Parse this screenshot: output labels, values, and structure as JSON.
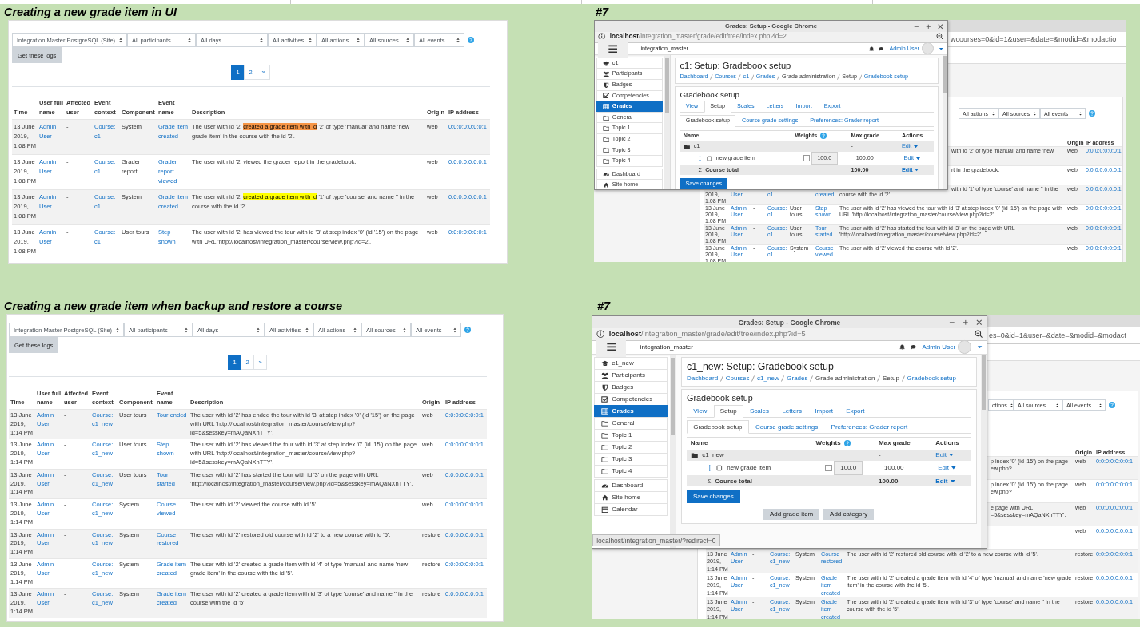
{
  "panels": [
    {
      "kind": "log",
      "heading": "Creating a new grade item in UI",
      "log": {
        "filters": [
          "Integration Master PostgreSQL (Site)",
          "All participants",
          "All days",
          "All activities",
          "All actions",
          "All sources",
          "All events"
        ],
        "get_button": "Get these logs",
        "pages": [
          {
            "label": "1",
            "selected": true
          },
          {
            "label": "2",
            "selected": false
          },
          {
            "label": "»",
            "selected": false
          }
        ],
        "columns": [
          "Time",
          "User full name",
          "Affected user",
          "Event context",
          "Component",
          "Event name",
          "Description",
          "Origin",
          "IP address"
        ],
        "rows": [
          {
            "time": "13 June 2019, 1:08 PM",
            "user": "Admin User",
            "affected": "-",
            "context": "Course: c1",
            "component": "System",
            "event": "Grade item created",
            "description": [
              {
                "text": "The user with id '2' "
              },
              {
                "text": "created a grade item with id",
                "color": "#f79646"
              },
              {
                "text": " '2' of type 'manual' and name 'new grade item' in the course with the id '2'."
              }
            ],
            "origin": "web",
            "ip": "0:0:0:0:0:0:0:1"
          },
          {
            "time": "13 June 2019, 1:08 PM",
            "user": "Admin User",
            "affected": "-",
            "context": "Course: c1",
            "component": "Grader report",
            "event": "Grader report viewed",
            "description": [
              {
                "text": "The user with id '2' viewed the grader report in the gradebook."
              }
            ],
            "origin": "web",
            "ip": "0:0:0:0:0:0:0:1"
          },
          {
            "time": "13 June 2019, 1:08 PM",
            "user": "Admin User",
            "affected": "-",
            "context": "Course: c1",
            "component": "System",
            "event": "Grade item created",
            "description": [
              {
                "text": "The user with id '2' "
              },
              {
                "text": "created a grade item with id",
                "color": "#ffff00"
              },
              {
                "text": " '1' of type 'course' and name '' in the course with the id '2'."
              }
            ],
            "origin": "web",
            "ip": "0:0:0:0:0:0:0:1"
          },
          {
            "time": "13 June 2019, 1:08 PM",
            "user": "Admin User",
            "affected": "-",
            "context": "Course: c1",
            "component": "User tours",
            "event": "Step shown",
            "description": [
              {
                "text": "The user with id '2' has viewed the tour with id '3' at step index '0' (id '15') on the page with URL 'http://localhost/integration_master/course/view.php?id=2'."
              }
            ],
            "origin": "web",
            "ip": "0:0:0:0:0:0:0:1"
          }
        ]
      }
    },
    {
      "kind": "popup",
      "heading": "#7",
      "background": {
        "url_fragment": "wcourses=0&id=1&user=&date=&modid=&modactio",
        "filters": [
          "All actions",
          "All sources",
          "All events"
        ],
        "columns": [
          "Origin",
          "IP address"
        ],
        "rows": [
          {
            "kind": "beside",
            "fragment": [
              "with id '2' of type 'manual' and name 'new"
            ],
            "origin": "web",
            "ip": "0:0:0:0:0:0:0:1"
          },
          {
            "kind": "beside",
            "fragment": [
              "rt in the gradebook."
            ],
            "origin": "web",
            "ip": "0:0:0:0:0:0:0:1"
          },
          {
            "kind": "edge",
            "time": "2019, 1:08 PM",
            "user": "User",
            "context": "c1",
            "event": "created",
            "fragment": [
              "with id '1' of type 'course' and name '' in the"
            ],
            "description": "course with the id '2'.",
            "origin": "web",
            "ip": "0:0:0:0:0:0:0:1"
          },
          {
            "kind": "full",
            "time": "13 June 2019, 1:08 PM",
            "user": "Admin User",
            "affected": "-",
            "context": "Course: c1",
            "component": "User tours",
            "event": "Step shown",
            "description": "The user with id '2' has viewed the tour with id '3' at step index '0' (id '15') on the page with URL 'http://localhost/integration_master/course/view.php?id=2'.",
            "origin": "web",
            "ip": "0:0:0:0:0:0:0:1"
          },
          {
            "kind": "full",
            "time": "13 June 2019, 1:08 PM",
            "user": "Admin User",
            "affected": "-",
            "context": "Course: c1",
            "component": "User tours",
            "event": "Tour started",
            "description": "The user with id '2' has started the tour with id '3' on the page with URL 'http://localhost/integration_master/course/view.php?id=2'.",
            "origin": "web",
            "ip": "0:0:0:0:0:0:0:1"
          },
          {
            "kind": "full",
            "time": "13 June 2019, 1:08 PM",
            "user": "Admin User",
            "affected": "-",
            "context": "Course: c1",
            "component": "System",
            "event": "Course viewed",
            "description": "The user with id '2' viewed the course with id '2'.",
            "origin": "web",
            "ip": "0:0:0:0:0:0:0:1"
          }
        ]
      },
      "window": {
        "title": "Grades: Setup - Google Chrome",
        "url_host": "localhost",
        "url_path": "/integration_master/grade/edit/tree/index.php?id=2",
        "site_name": "integration_master",
        "user_name": "Admin User",
        "nav_groups": [
          {
            "items": [
              {
                "kind": "course",
                "label": "c1",
                "selected": false
              },
              {
                "kind": "users",
                "label": "Participants",
                "selected": false
              },
              {
                "kind": "badge",
                "label": "Badges",
                "selected": false
              },
              {
                "kind": "competency",
                "label": "Competencies",
                "selected": false
              },
              {
                "kind": "grades",
                "label": "Grades",
                "selected": true
              },
              {
                "kind": "section",
                "label": "General",
                "selected": false
              },
              {
                "kind": "section",
                "label": "Topic 1",
                "selected": false
              },
              {
                "kind": "section",
                "label": "Topic 2",
                "selected": false
              },
              {
                "kind": "section",
                "label": "Topic 3",
                "selected": false
              },
              {
                "kind": "section",
                "label": "Topic 4",
                "selected": false
              }
            ]
          },
          {
            "items": [
              {
                "kind": "dashboard",
                "label": "Dashboard",
                "selected": false
              },
              {
                "kind": "home",
                "label": "Site home",
                "selected": false
              }
            ]
          }
        ],
        "page_title": "c1: Setup: Gradebook setup",
        "breadcrumbs": [
          {
            "label": "Dashboard",
            "link": true
          },
          {
            "label": "Courses",
            "link": true
          },
          {
            "label": "c1",
            "link": true
          },
          {
            "label": "Grades",
            "link": true
          },
          {
            "label": "Grade administration",
            "link": false
          },
          {
            "label": "Setup",
            "link": false
          },
          {
            "label": "Gradebook setup",
            "link": true
          }
        ],
        "card_title": "Gradebook setup",
        "tabs": [
          {
            "label": "View",
            "selected": false
          },
          {
            "label": "Setup",
            "selected": true
          },
          {
            "label": "Scales",
            "selected": false
          },
          {
            "label": "Letters",
            "selected": false
          },
          {
            "label": "Import",
            "selected": false
          },
          {
            "label": "Export",
            "selected": false
          }
        ],
        "subtabs": [
          {
            "label": "Gradebook setup",
            "selected": true
          },
          {
            "label": "Course grade settings",
            "selected": false
          },
          {
            "label": "Preferences: Grader report",
            "selected": false
          }
        ],
        "grade_table": {
          "columns": [
            "Name",
            "Weights",
            "Max grade",
            "Actions"
          ],
          "rows": [
            {
              "kind": "category",
              "name": "c1",
              "max_grade": "-",
              "action": "Edit"
            },
            {
              "kind": "item",
              "name": "new grade item",
              "weight": "100.0",
              "weight_checked": false,
              "max_grade": "100.00",
              "action": "Edit"
            },
            {
              "kind": "total",
              "symbol": "Σ",
              "name": "Course total",
              "max_grade": "100.00",
              "action": "Edit"
            }
          ]
        },
        "save_button": "Save changes"
      }
    },
    {
      "kind": "log",
      "heading": "Creating a new grade item when backup and restore a course",
      "log": {
        "filters": [
          "Integration Master PostgreSQL (Site)",
          "All participants",
          "All days",
          "All activities",
          "All actions",
          "All sources",
          "All events"
        ],
        "get_button": "Get these logs",
        "pages": [
          {
            "label": "1",
            "selected": true
          },
          {
            "label": "2",
            "selected": false
          },
          {
            "label": "»",
            "selected": false
          }
        ],
        "columns": [
          "Time",
          "User full name",
          "Affected user",
          "Event context",
          "Component",
          "Event name",
          "Description",
          "Origin",
          "IP address"
        ],
        "rows": [
          {
            "time": "13 June 2019, 1:14 PM",
            "user": "Admin User",
            "affected": "-",
            "context": "Course: c1_new",
            "component": "User tours",
            "event": "Tour ended",
            "description": [
              {
                "text": "The user with id '2' has ended the tour with id '3' at step index '0' (id '15') on the page with URL 'http://localhost/integration_master/course/view.php?id=5&sesskey=mAQaNXhTTY'."
              }
            ],
            "origin": "web",
            "ip": "0:0:0:0:0:0:0:1"
          },
          {
            "time": "13 June 2019, 1:14 PM",
            "user": "Admin User",
            "affected": "-",
            "context": "Course: c1_new",
            "component": "User tours",
            "event": "Step shown",
            "description": [
              {
                "text": "The user with id '2' has viewed the tour with id '3' at step index '0' (id '15') on the page with URL 'http://localhost/integration_master/course/view.php?id=5&sesskey=mAQaNXhTTY'."
              }
            ],
            "origin": "web",
            "ip": "0:0:0:0:0:0:0:1"
          },
          {
            "time": "13 June 2019, 1:14 PM",
            "user": "Admin User",
            "affected": "-",
            "context": "Course: c1_new",
            "component": "User tours",
            "event": "Tour started",
            "description": [
              {
                "text": "The user with id '2' has started the tour with id '3' on the page with URL 'http://localhost/integration_master/course/view.php?id=5&sesskey=mAQaNXhTTY'."
              }
            ],
            "origin": "web",
            "ip": "0:0:0:0:0:0:0:1"
          },
          {
            "time": "13 June 2019, 1:14 PM",
            "user": "Admin User",
            "affected": "-",
            "context": "Course: c1_new",
            "component": "System",
            "event": "Course viewed",
            "description": [
              {
                "text": "The user with id '2' viewed the course with id '5'."
              }
            ],
            "origin": "web",
            "ip": "0:0:0:0:0:0:0:1"
          },
          {
            "time": "13 June 2019, 1:14 PM",
            "user": "Admin User",
            "affected": "-",
            "context": "Course: c1_new",
            "component": "System",
            "event": "Course restored",
            "description": [
              {
                "text": "The user with id '2' restored old course with id '2' to a new course with id '5'."
              }
            ],
            "origin": "restore",
            "ip": "0:0:0:0:0:0:0:1"
          },
          {
            "time": "13 June 2019, 1:14 PM",
            "user": "Admin User",
            "affected": "-",
            "context": "Course: c1_new",
            "component": "System",
            "event": "Grade item created",
            "description": [
              {
                "text": "The user with id '2' created a grade item with id '4' of type 'manual' and name 'new grade item' in the course with the id '5'."
              }
            ],
            "origin": "restore",
            "ip": "0:0:0:0:0:0:0:1"
          },
          {
            "time": "13 June 2019, 1:14 PM",
            "user": "Admin User",
            "affected": "-",
            "context": "Course: c1_new",
            "component": "System",
            "event": "Grade item created",
            "description": [
              {
                "text": "The user with id '2' created a grade item with id '3' of type 'course' and name '' in the course with the id '5'."
              }
            ],
            "origin": "restore",
            "ip": "0:0:0:0:0:0:0:1"
          }
        ]
      }
    },
    {
      "kind": "popup",
      "heading": "#7",
      "background": {
        "url_fragment": "es=0&id=1&user=&date=&modid=&modact",
        "filters": [
          "ctions",
          "All sources",
          "All events"
        ],
        "columns": [
          "Origin",
          "IP address"
        ],
        "rows": [
          {
            "kind": "beside",
            "fragment": [
              "p index '0' (id '15') on the page",
              "ew.php?"
            ],
            "origin": "web",
            "ip": "0:0:0:0:0:0:0:1"
          },
          {
            "kind": "beside",
            "fragment": [
              "p index '0' (id '15') on the page",
              "ew.php?"
            ],
            "origin": "web",
            "ip": "0:0:0:0:0:0:0:1"
          },
          {
            "kind": "beside",
            "fragment": [
              "e page with URL",
              "=5&sesskey=mAQaNXhTTY'."
            ],
            "origin": "web",
            "ip": "0:0:0:0:0:0:0:1"
          },
          {
            "kind": "beside",
            "origin": "web",
            "ip": "0:0:0:0:0:0:0:1"
          },
          {
            "kind": "full",
            "time": "13 June 2019, 1:14 PM",
            "user": "Admin User",
            "affected": "-",
            "context": "Course: c1_new",
            "component": "System",
            "event": "Course restored",
            "description": "The user with id '2' restored old course with id '2' to a new course with id '5'.",
            "origin": "restore",
            "ip": "0:0:0:0:0:0:0:1"
          },
          {
            "kind": "full",
            "time": "13 June 2019, 1:14 PM",
            "user": "Admin User",
            "affected": "-",
            "context": "Course: c1_new",
            "component": "System",
            "event": "Grade item created",
            "description": "The user with id '2' created a grade item with id '4' of type 'manual' and name 'new grade item' in the course with the id '5'.",
            "origin": "restore",
            "ip": "0:0:0:0:0:0:0:1"
          },
          {
            "kind": "full",
            "time": "13 June 2019, 1:14 PM",
            "user": "Admin User",
            "affected": "-",
            "context": "Course: c1_new",
            "component": "System",
            "event": "Grade item created",
            "description": "The user with id '2' created a grade item with id '3' of type 'course' and name '' in the course with the id '5'.",
            "origin": "restore",
            "ip": "0:0:0:0:0:0:0:1"
          }
        ]
      },
      "window": {
        "title": "Grades: Setup - Google Chrome",
        "url_host": "localhost",
        "url_path": "/integration_master/grade/edit/tree/index.php?id=5",
        "site_name": "integration_master",
        "user_name": "Admin User",
        "nav_groups": [
          {
            "items": [
              {
                "kind": "course",
                "label": "c1_new",
                "selected": false
              },
              {
                "kind": "users",
                "label": "Participants",
                "selected": false
              },
              {
                "kind": "badge",
                "label": "Badges",
                "selected": false
              },
              {
                "kind": "competency",
                "label": "Competencies",
                "selected": false
              },
              {
                "kind": "grades",
                "label": "Grades",
                "selected": true
              },
              {
                "kind": "section",
                "label": "General",
                "selected": false
              },
              {
                "kind": "section",
                "label": "Topic 1",
                "selected": false
              },
              {
                "kind": "section",
                "label": "Topic 2",
                "selected": false
              },
              {
                "kind": "section",
                "label": "Topic 3",
                "selected": false
              },
              {
                "kind": "section",
                "label": "Topic 4",
                "selected": false
              }
            ]
          },
          {
            "items": [
              {
                "kind": "dashboard",
                "label": "Dashboard",
                "selected": false
              },
              {
                "kind": "home",
                "label": "Site home",
                "selected": false
              },
              {
                "kind": "calendar",
                "label": "Calendar",
                "selected": false
              }
            ]
          }
        ],
        "page_title": "c1_new: Setup: Gradebook setup",
        "breadcrumbs": [
          {
            "label": "Dashboard",
            "link": true
          },
          {
            "label": "Courses",
            "link": true
          },
          {
            "label": "c1_new",
            "link": true
          },
          {
            "label": "Grades",
            "link": true
          },
          {
            "label": "Grade administration",
            "link": false
          },
          {
            "label": "Setup",
            "link": false
          },
          {
            "label": "Gradebook setup",
            "link": true
          }
        ],
        "card_title": "Gradebook setup",
        "tabs": [
          {
            "label": "View",
            "selected": false
          },
          {
            "label": "Setup",
            "selected": true
          },
          {
            "label": "Scales",
            "selected": false
          },
          {
            "label": "Letters",
            "selected": false
          },
          {
            "label": "Import",
            "selected": false
          },
          {
            "label": "Export",
            "selected": false
          }
        ],
        "subtabs": [
          {
            "label": "Gradebook setup",
            "selected": true
          },
          {
            "label": "Course grade settings",
            "selected": false
          },
          {
            "label": "Preferences: Grader report",
            "selected": false
          }
        ],
        "grade_table": {
          "columns": [
            "Name",
            "Weights",
            "Max grade",
            "Actions"
          ],
          "rows": [
            {
              "kind": "category",
              "name": "c1_new",
              "max_grade": "-",
              "action": "Edit"
            },
            {
              "kind": "item",
              "name": "new grade item",
              "weight": "100.0",
              "weight_checked": false,
              "max_grade": "100.00",
              "action": "Edit"
            },
            {
              "kind": "total",
              "symbol": "Σ",
              "name": "Course total",
              "max_grade": "100.00",
              "action": "Edit"
            }
          ]
        },
        "save_button": "Save changes",
        "add_buttons": [
          "Add grade item",
          "Add category"
        ],
        "status_url": "localhost/integration_master/?redirect=0"
      }
    }
  ]
}
